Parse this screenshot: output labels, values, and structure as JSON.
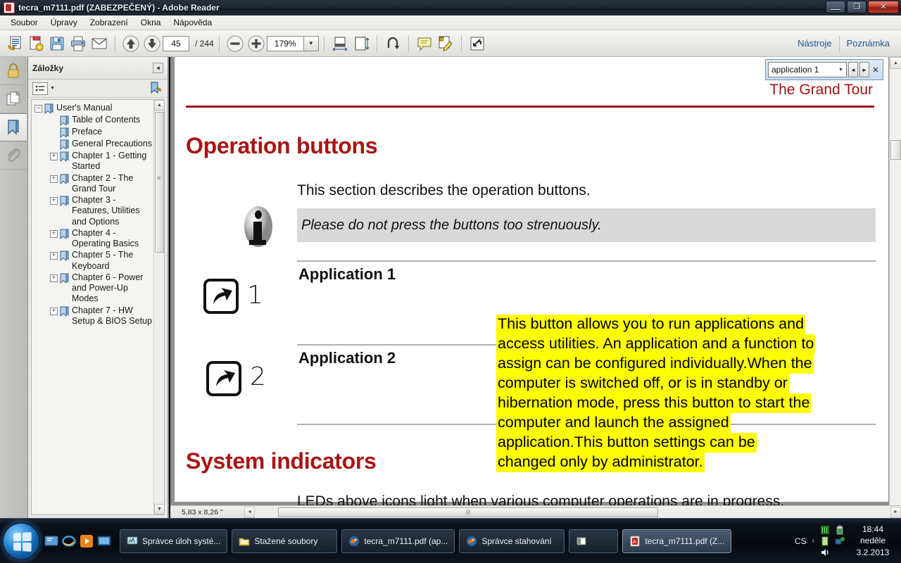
{
  "window": {
    "title": "tecra_m7111.pdf (ZABEZPEČENÝ) - Adobe Reader",
    "minimize_label": "—",
    "restore_label": "❐",
    "close_label": "✕"
  },
  "menu": {
    "items": [
      {
        "label": "Soubor",
        "name": "menu-soubor"
      },
      {
        "label": "Úpravy",
        "name": "menu-upravy"
      },
      {
        "label": "Zobrazení",
        "name": "menu-zobrazeni"
      },
      {
        "label": "Okna",
        "name": "menu-okna"
      },
      {
        "label": "Nápověda",
        "name": "menu-napoveda"
      }
    ]
  },
  "toolbar": {
    "page_number": "45",
    "page_total": "/ 244",
    "zoom_level": "179%",
    "zoom_dropdown_glyph": "▼",
    "tools_label": "Nástroje",
    "comment_label": "Poznámka"
  },
  "sidebar": {
    "rail": [
      {
        "name": "security-lock-icon",
        "label": "Zabezpečení"
      },
      {
        "name": "page-thumbnails-icon",
        "label": "Stránky"
      },
      {
        "name": "bookmarks-icon",
        "label": "Záložky"
      },
      {
        "name": "attachments-paperclip-icon",
        "label": "Přílohy"
      }
    ],
    "panel_title": "Záložky",
    "collapse_glyph": "◄",
    "options_caret": "▼",
    "bookmarks": [
      {
        "label": "User's Manual",
        "level": 1,
        "expander": "−"
      },
      {
        "label": "Table of Contents",
        "level": 2,
        "expander": ""
      },
      {
        "label": "Preface",
        "level": 2,
        "expander": ""
      },
      {
        "label": "General Precautions",
        "level": 2,
        "expander": ""
      },
      {
        "label": "Chapter 1 - Getting Started",
        "level": 2,
        "expander": "+"
      },
      {
        "label": "Chapter 2 - The Grand Tour",
        "level": 2,
        "expander": "+"
      },
      {
        "label": "Chapter 3 - Features, Utilities and Options",
        "level": 2,
        "expander": "+"
      },
      {
        "label": "Chapter 4 - Operating Basics",
        "level": 2,
        "expander": "+"
      },
      {
        "label": "Chapter 5 - The Keyboard",
        "level": 2,
        "expander": "+"
      },
      {
        "label": "Chapter 6 - Power and Power-Up Modes",
        "level": 2,
        "expander": "+"
      },
      {
        "label": "Chapter 7 - HW Setup & BIOS Setup",
        "level": 2,
        "expander": "+"
      }
    ]
  },
  "search": {
    "value": "application 1",
    "dropdown_glyph": "▼",
    "prev_glyph": "◄",
    "next_glyph": "►",
    "close_glyph": "✕"
  },
  "document": {
    "running_header": "The Grand Tour",
    "heading_1": "Operation buttons",
    "intro": "This section describes the operation buttons.",
    "note": "Please do not press the buttons too strenuously.",
    "rows": [
      {
        "label": "Application 1",
        "number": "1"
      },
      {
        "label": "Application 2",
        "number": "2"
      }
    ],
    "highlight_lines": [
      "This button allows you to run applications and",
      "access utilities. An application and a function to",
      "assign can be configured individually.When the",
      "computer is switched off, or is in standby or",
      "hibernation mode, press this button to start the",
      "computer and launch the assigned",
      "application.This button settings can be",
      "changed only by administrator."
    ],
    "heading_2": "System indicators",
    "bottom_text": "LEDs above icons  light when various computer operations are in progress."
  },
  "statusbar": {
    "dimensions": "5,83 x 8,26 \"",
    "left_arrow": "◄",
    "right_arrow": "►",
    "thumb_grip": "|||"
  },
  "taskbar": {
    "tasks": [
      {
        "label": "Správce úloh systé...",
        "name": "task-spravce-uloh",
        "active": false,
        "narrow": false
      },
      {
        "label": "Stažené soubory",
        "name": "task-stazene-soubory",
        "active": false,
        "narrow": false
      },
      {
        "label": "tecra_m7111.pdf (ap...",
        "name": "task-tecra-firefox",
        "active": false,
        "narrow": false
      },
      {
        "label": "Správce stahování",
        "name": "task-spravce-stahovani",
        "active": false,
        "narrow": false
      },
      {
        "label": "",
        "name": "task-unnamed-window",
        "active": false,
        "narrow": true
      },
      {
        "label": "tecra_m7111.pdf (Z...",
        "name": "task-tecra-adobe",
        "active": true,
        "narrow": false
      }
    ],
    "language": "CS",
    "chevron": "‹",
    "time": "18:44",
    "day": "neděle",
    "date": "3.2.2013"
  },
  "colors": {
    "heading_red": "#a81414",
    "header_red": "#9d1313",
    "highlight_yellow": "#ffff00",
    "link_blue": "#1f5a9c"
  }
}
